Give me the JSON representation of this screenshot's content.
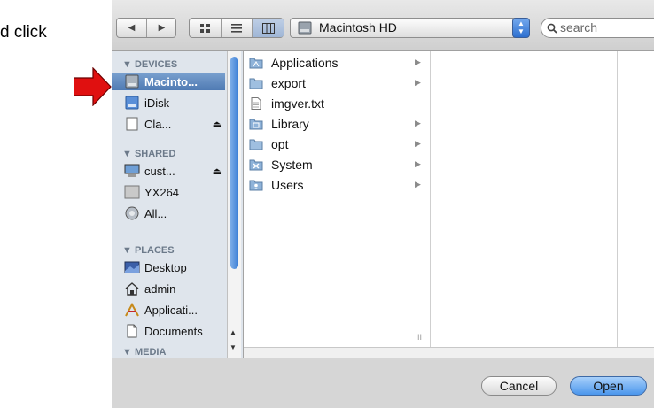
{
  "instruction": {
    "text": "d click"
  },
  "toolbar": {
    "back_icon": "◀",
    "forward_icon": "▶",
    "location": "Macintosh HD",
    "search_placeholder": "search"
  },
  "sidebar": {
    "sections": [
      {
        "label": "▼ DEVICES"
      },
      {
        "label": "▼ SHARED"
      },
      {
        "label": "▼ PLACES"
      },
      {
        "label": "▼ MEDIA"
      }
    ],
    "items": [
      {
        "label": "Macinto...",
        "icon": "hard-disk-icon",
        "selected": true
      },
      {
        "label": "iDisk",
        "icon": "idisk-icon"
      },
      {
        "label": "Cla...",
        "icon": "drive-icon",
        "eject": "⏏"
      },
      {
        "label": "cust...",
        "icon": "computer-icon",
        "eject": "⏏"
      },
      {
        "label": "YX264",
        "icon": "server-icon"
      },
      {
        "label": "All...",
        "icon": "network-icon"
      },
      {
        "label": "Desktop",
        "icon": "desktop-icon"
      },
      {
        "label": "admin",
        "icon": "home-icon"
      },
      {
        "label": "Applicati...",
        "icon": "applications-icon"
      },
      {
        "label": "Documents",
        "icon": "documents-icon"
      }
    ]
  },
  "browser": {
    "column1": [
      {
        "name": "Applications",
        "icon": "applications-folder-icon",
        "has_children": true
      },
      {
        "name": "export",
        "icon": "folder-icon",
        "has_children": true
      },
      {
        "name": "imgver.txt",
        "icon": "text-file-icon",
        "has_children": false
      },
      {
        "name": "Library",
        "icon": "library-folder-icon",
        "has_children": true
      },
      {
        "name": "opt",
        "icon": "folder-icon",
        "has_children": true
      },
      {
        "name": "System",
        "icon": "system-folder-icon",
        "has_children": true
      },
      {
        "name": "Users",
        "icon": "users-folder-icon",
        "has_children": true
      }
    ],
    "child_indicator": "▶",
    "column_resize_glyph": "II"
  },
  "footer": {
    "cancel_label": "Cancel",
    "open_label": "Open"
  },
  "colors": {
    "accent_blue": "#4b96ec",
    "selection": "#5b85bd",
    "arrow_red": "#e01010"
  }
}
